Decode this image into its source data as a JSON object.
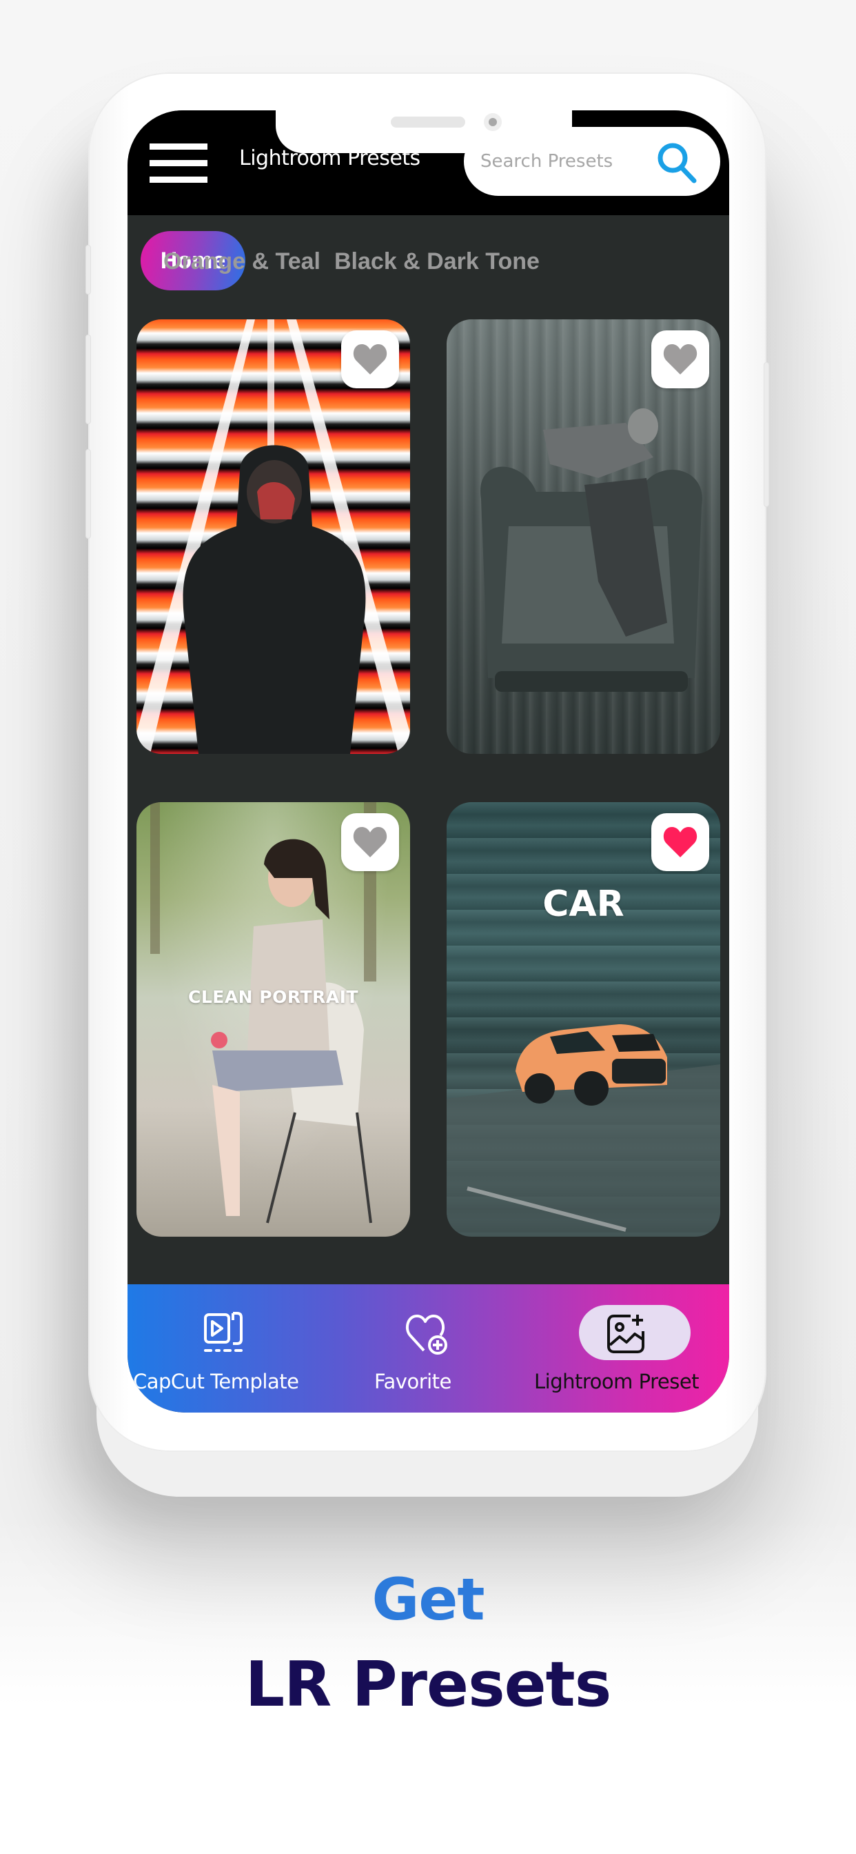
{
  "app": {
    "title": "Lightroom Presets",
    "search_placeholder": "Search Presets"
  },
  "tabs": [
    {
      "label": "Home",
      "active": true
    },
    {
      "label": "Orange & Teal",
      "active": false
    },
    {
      "label": "Black & Dark Tone",
      "active": false
    }
  ],
  "cards": [
    {
      "name": "neon-hoodie-preset",
      "label": "",
      "favorited": false
    },
    {
      "name": "bw-armchair-preset",
      "label": "",
      "favorited": false
    },
    {
      "name": "clean-portrait-preset",
      "label": "CLEAN PORTRAIT",
      "favorited": false
    },
    {
      "name": "car-preset",
      "label": "CAR",
      "favorited": true
    }
  ],
  "bottom_nav": [
    {
      "label": "CapCut Template",
      "icon": "video-template-icon",
      "active": false
    },
    {
      "label": "Favorite",
      "icon": "heart-plus-icon",
      "active": false
    },
    {
      "label": "Lightroom Preset",
      "icon": "image-plus-icon",
      "active": true
    }
  ],
  "promo": {
    "line1": "Get",
    "line2": "LR Presets"
  },
  "colors": {
    "accent_blue": "#2c7adb",
    "promo_navy": "#170d55",
    "favorite_active": "#ff1f5a",
    "favorite_inactive": "#9e9c9c",
    "search_icon": "#1aa0e6",
    "screen_bg": "#282c2b"
  }
}
